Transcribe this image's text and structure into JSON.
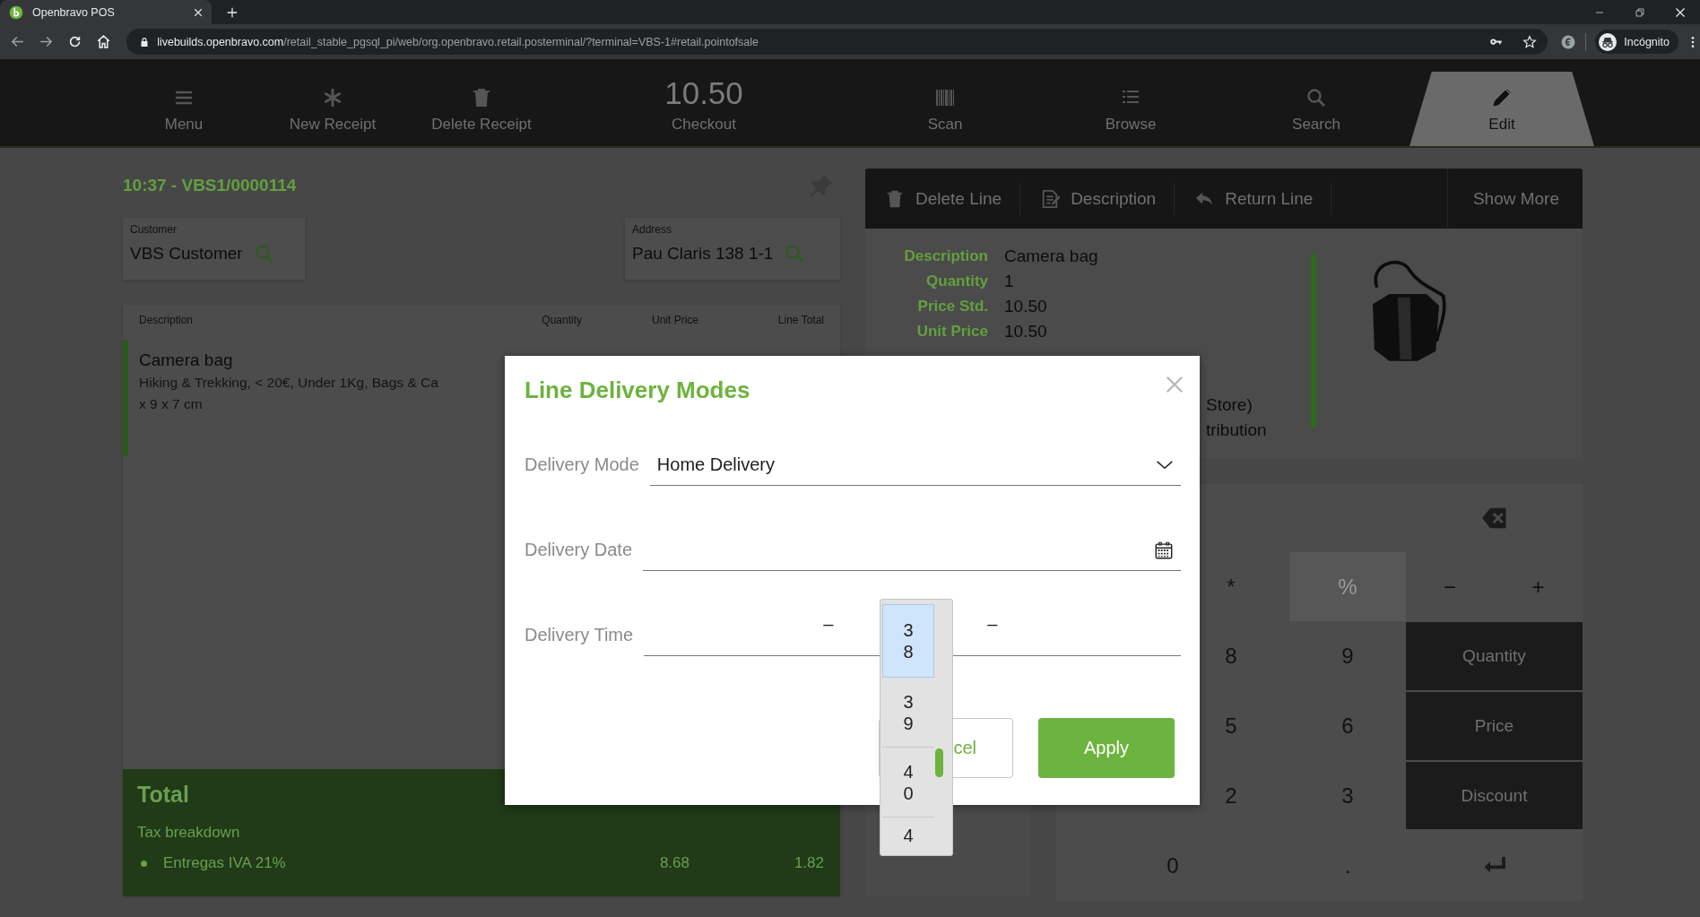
{
  "browser": {
    "tab_title": "Openbravo POS",
    "url": {
      "host": "livebuilds.openbravo.com",
      "path": "/retail_stable_pgsql_pi/web/org.openbravo.retail.posterminal/?terminal=VBS-1#retail.pointofsale"
    },
    "profile": "Incógnito"
  },
  "toolbar": [
    {
      "kind": "menu",
      "label": "Menu",
      "selected": false
    },
    {
      "kind": "new",
      "label": "New Receipt",
      "selected": false
    },
    {
      "kind": "delete",
      "label": "Delete Receipt",
      "selected": false
    },
    {
      "kind": "checkout",
      "amount": "10.50",
      "label": "Checkout",
      "selected": false
    },
    {
      "kind": "scan",
      "label": "Scan",
      "selected": false
    },
    {
      "kind": "browse",
      "label": "Browse",
      "selected": false
    },
    {
      "kind": "search",
      "label": "Search",
      "selected": false
    },
    {
      "kind": "edit",
      "label": "Edit",
      "selected": true
    }
  ],
  "receipt": {
    "title": "10:37 - VBS1/0000114",
    "customer": {
      "label": "Customer",
      "value": "VBS Customer"
    },
    "address": {
      "label": "Address",
      "value": "Pau Claris 138 1-1"
    },
    "columns": [
      "Description",
      "Quantity",
      "Unit Price",
      "Line Total"
    ],
    "lines": [
      {
        "name": "Camera bag",
        "details": [
          "Hiking & Trekking, < 20€, Under 1Kg, Bags & Ca",
          "x 9 x 7 cm"
        ]
      }
    ],
    "total": {
      "title": "Total",
      "tax_title": "Tax breakdown",
      "taxes": [
        {
          "name": "Entregas IVA 21%",
          "base": "8.68",
          "amount": "1.82"
        }
      ]
    }
  },
  "line_actions": [
    {
      "kind": "delete",
      "label": "Delete Line"
    },
    {
      "kind": "description",
      "label": "Description"
    },
    {
      "kind": "return",
      "label": "Return Line"
    },
    {
      "kind": "more",
      "label": "Show More"
    }
  ],
  "line_details": {
    "fields": [
      {
        "label": "Description",
        "value": "Camera bag"
      },
      {
        "label": "Quantity",
        "value": "1"
      },
      {
        "label": "Price Std.",
        "value": "10.50"
      },
      {
        "label": "Unit Price",
        "value": "10.50"
      }
    ],
    "notes": [
      "Store)",
      "tribution"
    ]
  },
  "keypad": [
    {
      "kind": "backspace"
    },
    {
      "kind": "op",
      "label": "*"
    },
    {
      "kind": "mode",
      "label": "%"
    },
    {
      "kind": "op",
      "label": "−"
    },
    {
      "kind": "op",
      "label": "+"
    },
    {
      "kind": "digit",
      "label": "8"
    },
    {
      "kind": "digit",
      "label": "9"
    },
    {
      "kind": "fn",
      "label": "Quantity"
    },
    {
      "kind": "digit",
      "label": "5"
    },
    {
      "kind": "digit",
      "label": "6"
    },
    {
      "kind": "fn",
      "label": "Price"
    },
    {
      "kind": "digit",
      "label": "2"
    },
    {
      "kind": "digit",
      "label": "3"
    },
    {
      "kind": "fn",
      "label": "Discount"
    },
    {
      "kind": "digit",
      "label": "0"
    },
    {
      "kind": "digit",
      "label": "."
    },
    {
      "kind": "enter"
    }
  ],
  "delivery_dialog": {
    "title": "Line Delivery Modes",
    "fields": [
      {
        "kind": "select",
        "label": "Delivery Mode",
        "value": "Home Delivery"
      },
      {
        "kind": "date",
        "label": "Delivery Date"
      },
      {
        "kind": "time",
        "label": "Delivery Time",
        "separators": [
          "–",
          "–"
        ]
      }
    ],
    "time_options": [
      {
        "label": "38",
        "selected": true
      },
      {
        "label": "39",
        "selected": false
      },
      {
        "label": "40",
        "selected": false
      },
      {
        "label": "4",
        "selected": false
      }
    ],
    "buttons": [
      {
        "kind": "secondary",
        "label": "cel"
      },
      {
        "kind": "primary",
        "label": "Apply"
      }
    ]
  }
}
